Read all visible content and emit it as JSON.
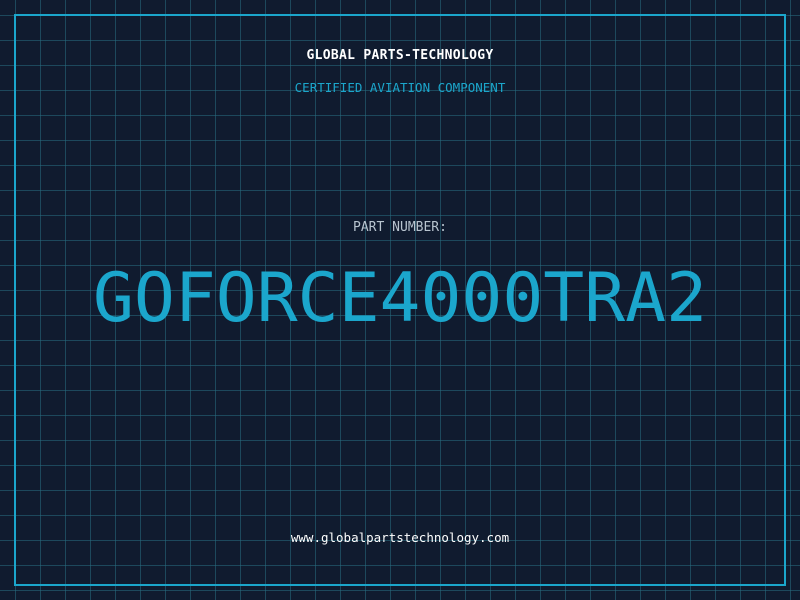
{
  "header": {
    "company": "GLOBAL PARTS-TECHNOLOGY",
    "subtitle": "CERTIFIED AVIATION COMPONENT"
  },
  "part": {
    "label": "PART NUMBER:",
    "number": "GOFORCE4000TRA2"
  },
  "footer": {
    "url": "www.globalpartstechnology.com"
  },
  "colors": {
    "background": "#101b2f",
    "accent": "#1ba6cc",
    "grid": "#286e82",
    "text": "#ffffff",
    "label": "#b8c4cf"
  }
}
